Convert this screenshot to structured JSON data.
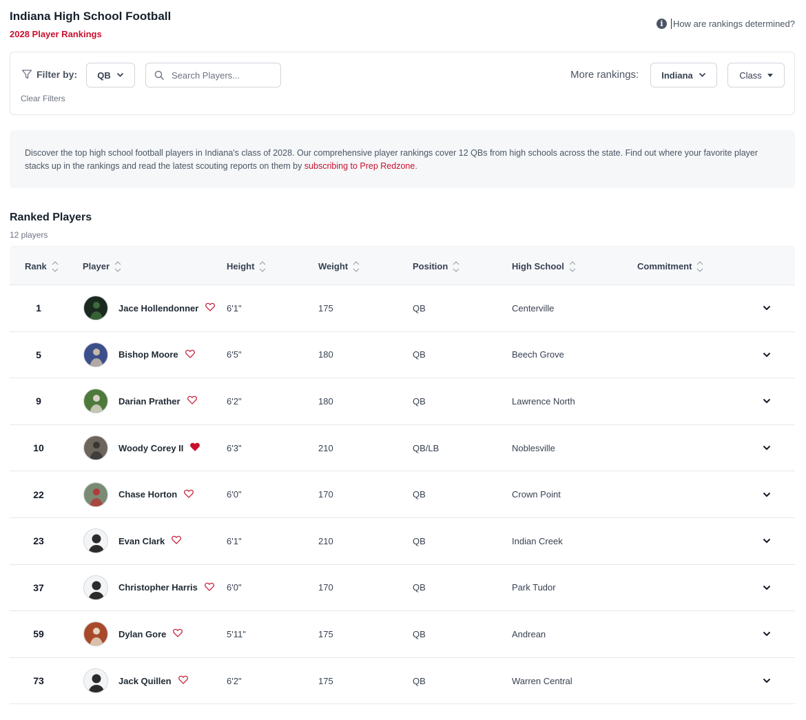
{
  "header": {
    "title": "Indiana High School Football",
    "subtitle": "2028 Player Rankings",
    "how_link": "How are rankings determined?"
  },
  "filters": {
    "label": "Filter by:",
    "position_value": "QB",
    "search_placeholder": "Search Players...",
    "clear_label": "Clear Filters",
    "more_rankings_label": "More rankings:",
    "state_value": "Indiana",
    "class_value": "Class"
  },
  "intro": {
    "text_before": "Discover the top high school football players in Indiana's class of 2028. Our comprehensive player rankings cover 12 QBs from high schools across the state. Find out where your favorite player stacks up in the rankings and read the latest scouting reports on them by ",
    "link_text": "subscribing to Prep Redzone",
    "text_after": "."
  },
  "ranked": {
    "title": "Ranked Players",
    "count": "12 players"
  },
  "table": {
    "columns": [
      "Rank",
      "Player",
      "Height",
      "Weight",
      "Position",
      "High School",
      "Commitment"
    ],
    "rows": [
      {
        "rank": "1",
        "name": "Jace Hollendonner",
        "height": "6'1\"",
        "weight": "175",
        "position": "QB",
        "school": "Centerville",
        "favorited": false,
        "avatar": "photo-dark"
      },
      {
        "rank": "5",
        "name": "Bishop Moore",
        "height": "6'5\"",
        "weight": "180",
        "position": "QB",
        "school": "Beech Grove",
        "favorited": false,
        "avatar": "photo-blue"
      },
      {
        "rank": "9",
        "name": "Darian Prather",
        "height": "6'2\"",
        "weight": "180",
        "position": "QB",
        "school": "Lawrence North",
        "favorited": false,
        "avatar": "photo-green"
      },
      {
        "rank": "10",
        "name": "Woody Corey II",
        "height": "6'3\"",
        "weight": "210",
        "position": "QB/LB",
        "school": "Noblesville",
        "favorited": true,
        "avatar": "photo-gray"
      },
      {
        "rank": "22",
        "name": "Chase Horton",
        "height": "6'0\"",
        "weight": "170",
        "position": "QB",
        "school": "Crown Point",
        "favorited": false,
        "avatar": "photo-field"
      },
      {
        "rank": "23",
        "name": "Evan Clark",
        "height": "6'1\"",
        "weight": "210",
        "position": "QB",
        "school": "Indian Creek",
        "favorited": false,
        "avatar": "silhouette"
      },
      {
        "rank": "37",
        "name": "Christopher Harris",
        "height": "6'0\"",
        "weight": "170",
        "position": "QB",
        "school": "Park Tudor",
        "favorited": false,
        "avatar": "silhouette"
      },
      {
        "rank": "59",
        "name": "Dylan Gore",
        "height": "5'11\"",
        "weight": "175",
        "position": "QB",
        "school": "Andrean",
        "favorited": false,
        "avatar": "photo-red"
      },
      {
        "rank": "73",
        "name": "Jack Quillen",
        "height": "6'2\"",
        "weight": "175",
        "position": "QB",
        "school": "Warren Central",
        "favorited": false,
        "avatar": "silhouette"
      }
    ]
  },
  "colors": {
    "accent": "#c8102e",
    "text": "#1f2933",
    "muted": "#6b7280",
    "border": "#e5e7eb"
  }
}
